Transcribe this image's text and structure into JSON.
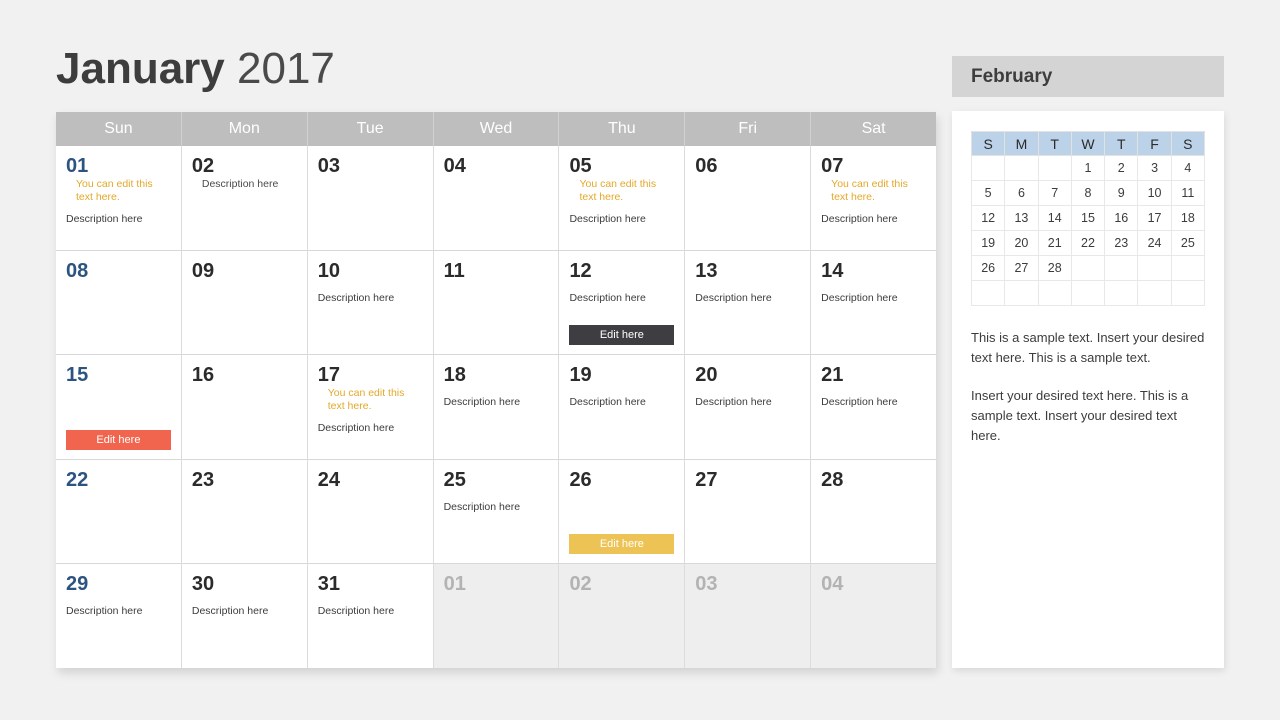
{
  "title": {
    "month": "January",
    "year": "2017"
  },
  "weekday_headers": [
    "Sun",
    "Mon",
    "Tue",
    "Wed",
    "Thu",
    "Fri",
    "Sat"
  ],
  "labels": {
    "note_text": "You can edit this text here.",
    "description_text": "Description here",
    "edit_button": "Edit here"
  },
  "colors": {
    "page_background": "#f1f1f1",
    "header_bar": "#bebebe",
    "sunday_number": "#2d5380",
    "note_gold": "#e3a829",
    "button_dark": "#3d3d42",
    "button_red": "#f1654f",
    "button_yellow": "#edc355",
    "other_month_cell": "#eeeeee",
    "side_header_bar": "#d4d4d4",
    "mini_header_blue": "#bcd2e8"
  },
  "weeks": [
    [
      {
        "day": "01",
        "sunday": true,
        "other": false,
        "note": "You can edit this text here.",
        "desc": "Description here",
        "desc_inline": false,
        "button": null
      },
      {
        "day": "02",
        "sunday": false,
        "other": false,
        "note": null,
        "desc": "Description here",
        "desc_inline": true,
        "button": null
      },
      {
        "day": "03",
        "sunday": false,
        "other": false,
        "note": null,
        "desc": null,
        "desc_inline": false,
        "button": null
      },
      {
        "day": "04",
        "sunday": false,
        "other": false,
        "note": null,
        "desc": null,
        "desc_inline": false,
        "button": null
      },
      {
        "day": "05",
        "sunday": false,
        "other": false,
        "note": "You can edit this text here.",
        "desc": "Description here",
        "desc_inline": false,
        "button": null
      },
      {
        "day": "06",
        "sunday": false,
        "other": false,
        "note": null,
        "desc": null,
        "desc_inline": false,
        "button": null
      },
      {
        "day": "07",
        "sunday": false,
        "other": false,
        "note": "You can edit this text here.",
        "desc": "Description here",
        "desc_inline": false,
        "button": null
      }
    ],
    [
      {
        "day": "08",
        "sunday": true,
        "other": false,
        "note": null,
        "desc": null,
        "desc_inline": false,
        "button": null
      },
      {
        "day": "09",
        "sunday": false,
        "other": false,
        "note": null,
        "desc": null,
        "desc_inline": false,
        "button": null
      },
      {
        "day": "10",
        "sunday": false,
        "other": false,
        "note": null,
        "desc": "Description here",
        "desc_inline": false,
        "button": null
      },
      {
        "day": "11",
        "sunday": false,
        "other": false,
        "note": null,
        "desc": null,
        "desc_inline": false,
        "button": null
      },
      {
        "day": "12",
        "sunday": false,
        "other": false,
        "note": null,
        "desc": "Description here",
        "desc_inline": false,
        "button": {
          "label": "Edit here",
          "style": "dark"
        }
      },
      {
        "day": "13",
        "sunday": false,
        "other": false,
        "note": null,
        "desc": "Description here",
        "desc_inline": false,
        "button": null
      },
      {
        "day": "14",
        "sunday": false,
        "other": false,
        "note": null,
        "desc": "Description here",
        "desc_inline": false,
        "button": null
      }
    ],
    [
      {
        "day": "15",
        "sunday": true,
        "other": false,
        "note": null,
        "desc": null,
        "desc_inline": false,
        "button": {
          "label": "Edit here",
          "style": "red"
        }
      },
      {
        "day": "16",
        "sunday": false,
        "other": false,
        "note": null,
        "desc": null,
        "desc_inline": false,
        "button": null
      },
      {
        "day": "17",
        "sunday": false,
        "other": false,
        "note": "You can edit this text here.",
        "desc": "Description here",
        "desc_inline": false,
        "button": null
      },
      {
        "day": "18",
        "sunday": false,
        "other": false,
        "note": null,
        "desc": "Description here",
        "desc_inline": false,
        "button": null
      },
      {
        "day": "19",
        "sunday": false,
        "other": false,
        "note": null,
        "desc": "Description here",
        "desc_inline": false,
        "button": null
      },
      {
        "day": "20",
        "sunday": false,
        "other": false,
        "note": null,
        "desc": "Description here",
        "desc_inline": false,
        "button": null
      },
      {
        "day": "21",
        "sunday": false,
        "other": false,
        "note": null,
        "desc": "Description here",
        "desc_inline": false,
        "button": null
      }
    ],
    [
      {
        "day": "22",
        "sunday": true,
        "other": false,
        "note": null,
        "desc": null,
        "desc_inline": false,
        "button": null
      },
      {
        "day": "23",
        "sunday": false,
        "other": false,
        "note": null,
        "desc": null,
        "desc_inline": false,
        "button": null
      },
      {
        "day": "24",
        "sunday": false,
        "other": false,
        "note": null,
        "desc": null,
        "desc_inline": false,
        "button": null
      },
      {
        "day": "25",
        "sunday": false,
        "other": false,
        "note": null,
        "desc": "Description here",
        "desc_inline": false,
        "button": null
      },
      {
        "day": "26",
        "sunday": false,
        "other": false,
        "note": null,
        "desc": null,
        "desc_inline": false,
        "button": {
          "label": "Edit here",
          "style": "yellow"
        }
      },
      {
        "day": "27",
        "sunday": false,
        "other": false,
        "note": null,
        "desc": null,
        "desc_inline": false,
        "button": null
      },
      {
        "day": "28",
        "sunday": false,
        "other": false,
        "note": null,
        "desc": null,
        "desc_inline": false,
        "button": null
      }
    ],
    [
      {
        "day": "29",
        "sunday": true,
        "other": false,
        "note": null,
        "desc": "Description here",
        "desc_inline": false,
        "button": null
      },
      {
        "day": "30",
        "sunday": false,
        "other": false,
        "note": null,
        "desc": "Description here",
        "desc_inline": false,
        "button": null
      },
      {
        "day": "31",
        "sunday": false,
        "other": false,
        "note": null,
        "desc": "Description here",
        "desc_inline": false,
        "button": null
      },
      {
        "day": "01",
        "sunday": false,
        "other": true,
        "note": null,
        "desc": null,
        "desc_inline": false,
        "button": null
      },
      {
        "day": "02",
        "sunday": false,
        "other": true,
        "note": null,
        "desc": null,
        "desc_inline": false,
        "button": null
      },
      {
        "day": "03",
        "sunday": false,
        "other": true,
        "note": null,
        "desc": null,
        "desc_inline": false,
        "button": null
      },
      {
        "day": "04",
        "sunday": false,
        "other": true,
        "note": null,
        "desc": null,
        "desc_inline": false,
        "button": null
      }
    ]
  ],
  "side_panel": {
    "header": "February",
    "mini_calendar": {
      "weekday_headers": [
        "S",
        "M",
        "T",
        "W",
        "T",
        "F",
        "S"
      ],
      "rows": [
        [
          "",
          "",
          "",
          "1",
          "2",
          "3",
          "4"
        ],
        [
          "5",
          "6",
          "7",
          "8",
          "9",
          "10",
          "11"
        ],
        [
          "12",
          "13",
          "14",
          "15",
          "16",
          "17",
          "18"
        ],
        [
          "19",
          "20",
          "21",
          "22",
          "23",
          "24",
          "25"
        ],
        [
          "26",
          "27",
          "28",
          "",
          "",
          "",
          ""
        ],
        [
          "",
          "",
          "",
          "",
          "",
          "",
          ""
        ]
      ]
    },
    "paragraphs": [
      "This is a sample text. Insert your desired text here. This is a sample text.",
      "Insert your desired text here. This is a sample text. Insert your desired text here."
    ]
  }
}
